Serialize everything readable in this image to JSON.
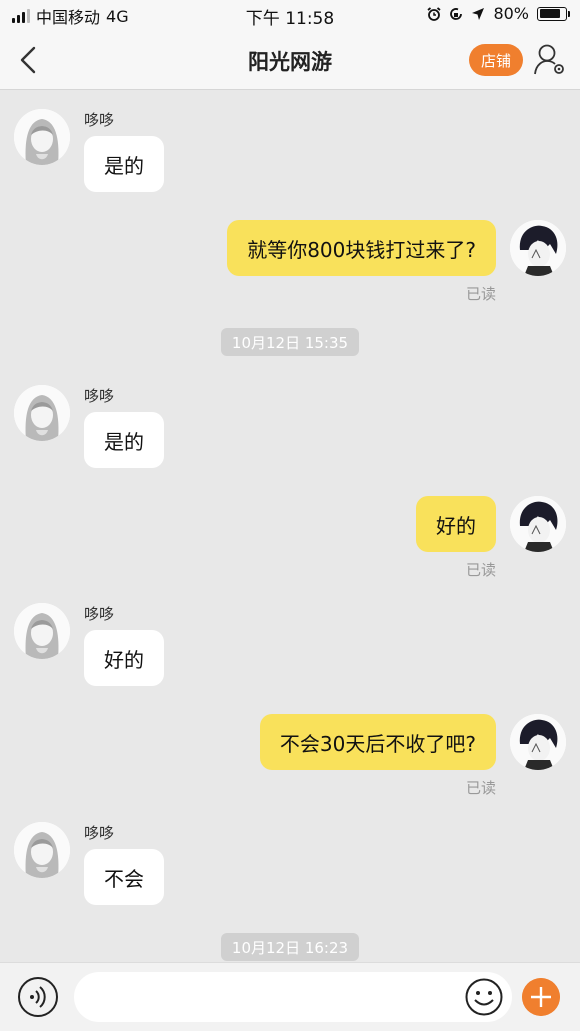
{
  "status_bar": {
    "carrier": "中国移动",
    "network": "4G",
    "time": "下午 11:58",
    "battery": "80%",
    "battery_level": 0.8
  },
  "nav": {
    "title": "阳光网游",
    "shop_label": "店铺"
  },
  "messages": [
    {
      "direction": "in",
      "sender": "哆哆",
      "text": "是的"
    },
    {
      "direction": "out",
      "text": "就等你800块钱打过来了?",
      "status": "已读"
    },
    {
      "type": "timestamp",
      "text": "10月12日 15:35"
    },
    {
      "direction": "in",
      "sender": "哆哆",
      "text": "是的"
    },
    {
      "direction": "out",
      "text": "好的",
      "status": "已读"
    },
    {
      "direction": "in",
      "sender": "哆哆",
      "text": "好的"
    },
    {
      "direction": "out",
      "text": "不会30天后不收了吧?",
      "status": "已读"
    },
    {
      "direction": "in",
      "sender": "哆哆",
      "text": "不会"
    },
    {
      "type": "timestamp",
      "text": "10月12日 16:23"
    }
  ],
  "input": {
    "placeholder": "",
    "value": ""
  },
  "icons": {
    "back": "chevron-left-icon",
    "profile": "user-settings-icon",
    "voice": "voice-icon",
    "emoji": "emoji-icon",
    "more": "plus-icon"
  },
  "colors": {
    "accent": "#f07f2e",
    "outgoing_bubble": "#f9e15b",
    "incoming_bubble": "#ffffff",
    "chat_background": "#e8e8e8"
  }
}
